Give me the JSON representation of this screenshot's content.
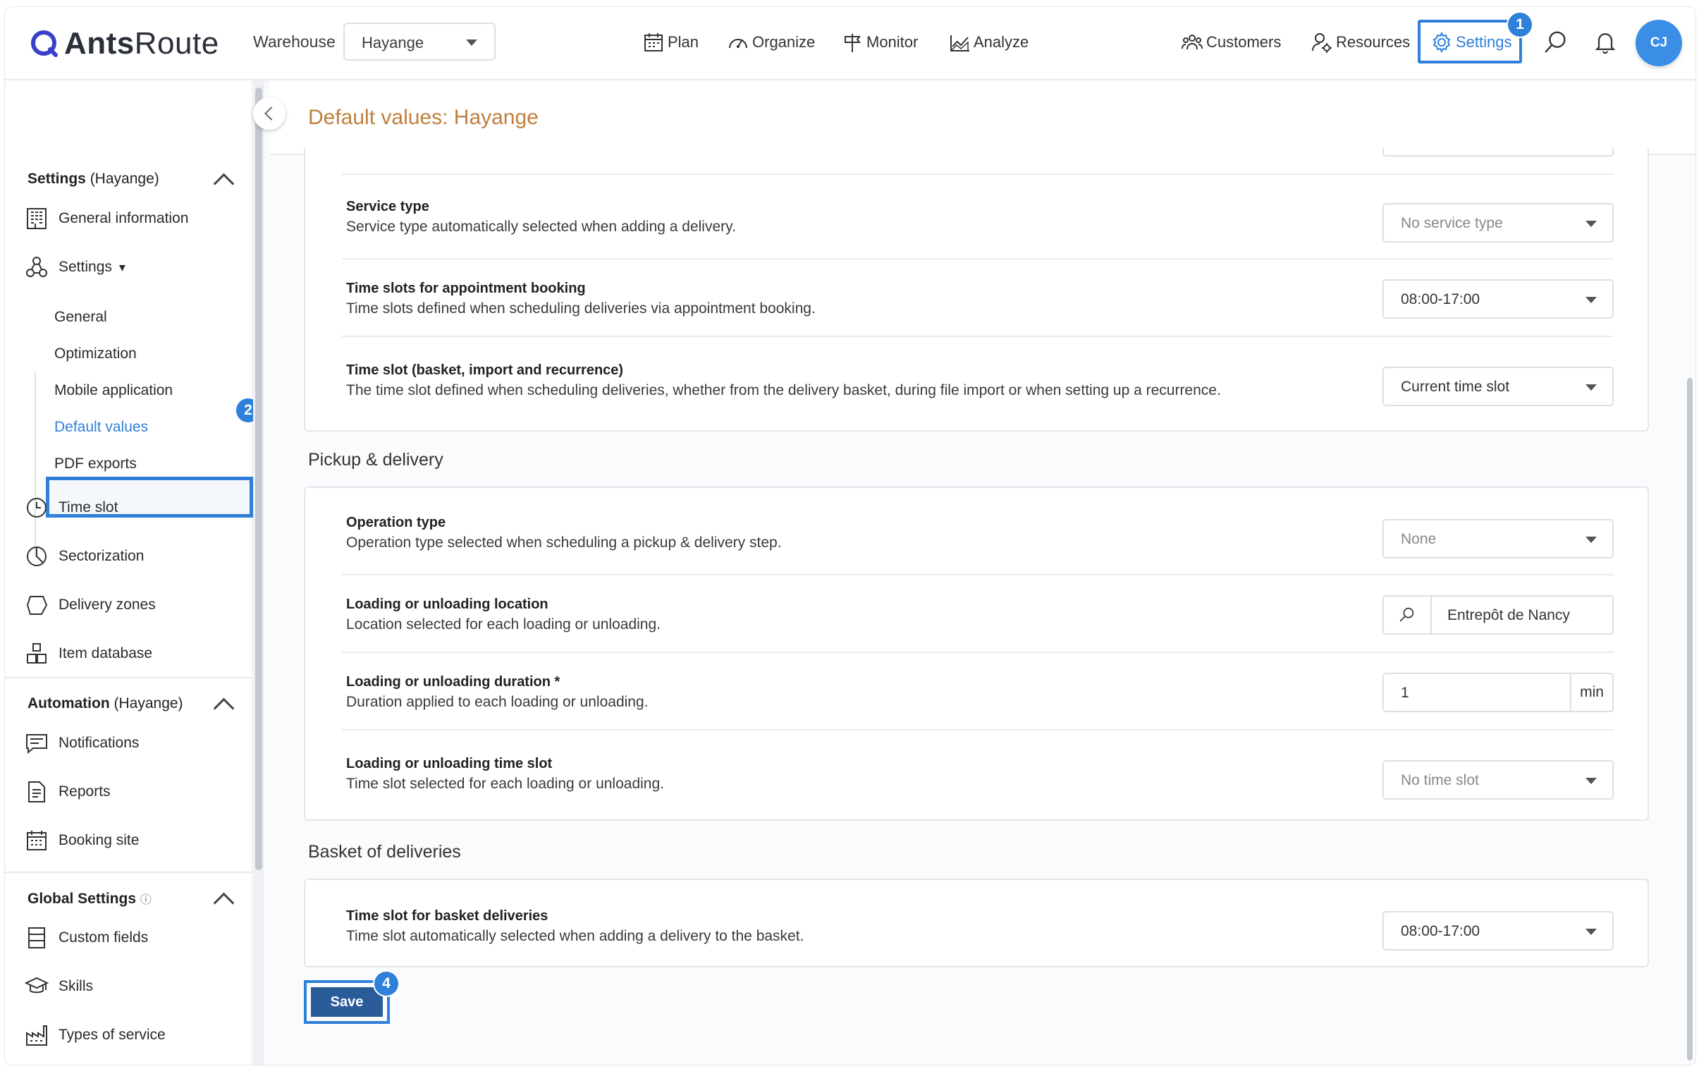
{
  "header": {
    "logo_bold": "Ants",
    "logo_rest": "Route",
    "warehouse_label": "Warehouse",
    "warehouse_value": "Hayange",
    "nav": [
      "Plan",
      "Organize",
      "Monitor",
      "Analyze"
    ],
    "right_nav": [
      "Customers",
      "Resources",
      "Settings"
    ],
    "avatar": "CJ",
    "badges": {
      "settings": "1",
      "default_values": "2",
      "save": "4"
    }
  },
  "sidebar": {
    "settings_section": {
      "title": "Settings",
      "scope": "(Hayange)"
    },
    "items1": [
      "General information",
      "Settings"
    ],
    "settings_caret": "▾",
    "subitems": [
      "General",
      "Optimization",
      "Mobile application",
      "Default values",
      "PDF exports"
    ],
    "items2": [
      "Time slot",
      "Sectorization",
      "Delivery zones",
      "Item database"
    ],
    "automation_section": {
      "title": "Automation",
      "scope": "(Hayange)"
    },
    "items3": [
      "Notifications",
      "Reports",
      "Booking site"
    ],
    "global_section": {
      "title": "Global Settings",
      "info": "ⓘ"
    },
    "items4": [
      "Custom fields",
      "Skills",
      "Types of service"
    ]
  },
  "page": {
    "title": "Default values: Hayange",
    "card1": [
      {
        "title": "Service type",
        "desc": "Service type automatically selected when adding a delivery.",
        "value": "No service type"
      },
      {
        "title": "Time slots for appointment booking",
        "desc": "Time slots defined when scheduling deliveries via appointment booking.",
        "value": "08:00-17:00"
      },
      {
        "title": "Time slot (basket, import and recurrence)",
        "desc": "The time slot defined when scheduling deliveries, whether from the delivery basket, during file import or when setting up a recurrence.",
        "value": "Current time slot"
      }
    ],
    "pickup_section": "Pickup & delivery",
    "pickup": {
      "operation": {
        "title": "Operation type",
        "desc": "Operation type selected when scheduling a pickup & delivery step.",
        "value": "None"
      },
      "location": {
        "title": "Loading or unloading location",
        "desc": "Location selected for each loading or unloading.",
        "value": "Entrepôt de Nancy"
      },
      "duration": {
        "title": "Loading or unloading duration *",
        "desc": "Duration applied to each loading or unloading.",
        "value": "1",
        "unit": "min"
      },
      "timeslot": {
        "title": "Loading or unloading time slot",
        "desc": "Time slot selected for each loading or unloading.",
        "value": "No time slot"
      }
    },
    "basket_section": "Basket of deliveries",
    "basket": {
      "title": "Time slot for basket deliveries",
      "desc": "Time slot automatically selected when adding a delivery to the basket.",
      "value": "08:00-17:00"
    },
    "save": "Save"
  }
}
